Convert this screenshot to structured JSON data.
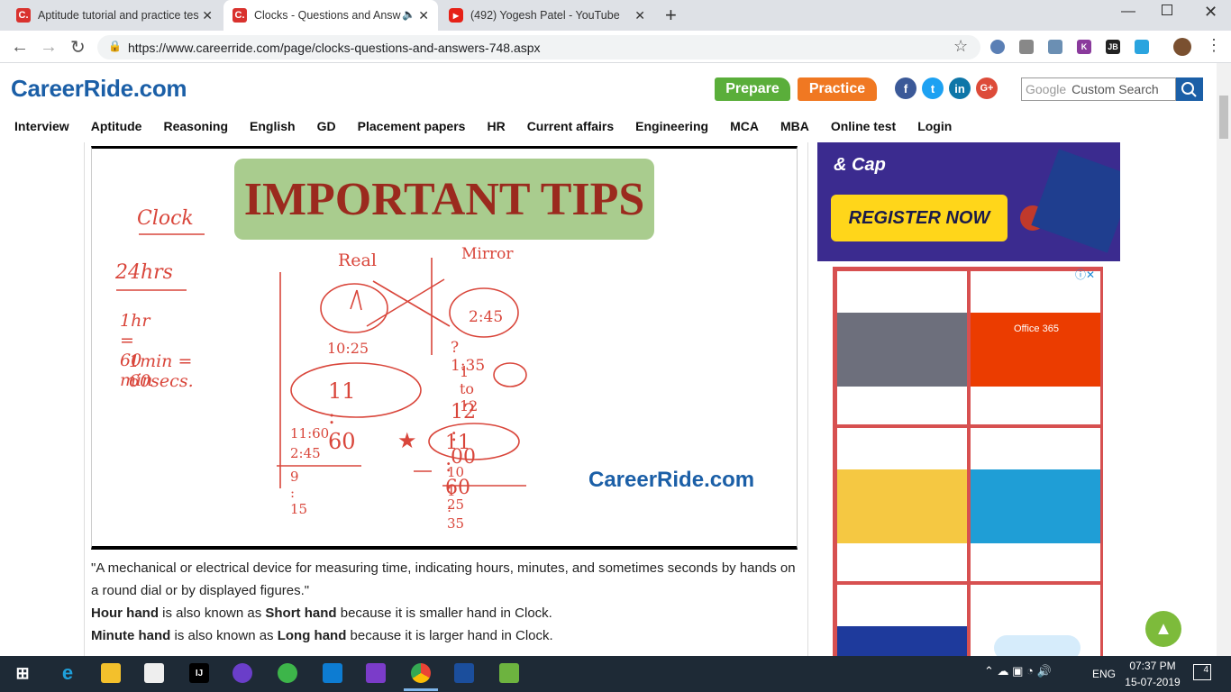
{
  "browser": {
    "tabs": [
      {
        "title": "Aptitude tutorial and practice tes",
        "favicon": "C."
      },
      {
        "title": "Clocks - Questions and Answ",
        "favicon": "C."
      },
      {
        "title": "(492) Yogesh Patel - YouTube"
      }
    ],
    "url": "https://www.careerride.com/page/clocks-questions-and-answers-748.aspx"
  },
  "site": {
    "logo": "CareerRide.com",
    "prepare_label": "Prepare",
    "practice_label": "Practice",
    "search_placeholder": "Custom Search",
    "google_label": "Google",
    "nav": [
      "Interview",
      "Aptitude",
      "Reasoning",
      "English",
      "GD",
      "Placement papers",
      "HR",
      "Current affairs",
      "Engineering",
      "MCA",
      "MBA",
      "Online test",
      "Login"
    ]
  },
  "image": {
    "tips_title": "IMPORTANT TIPS",
    "watermark": "CareerRide.com",
    "notes": {
      "clock": "Clock",
      "hrs": "24hrs",
      "hr": "1hr = 60 min",
      "min": "1min = 60secs.",
      "real": "Real",
      "mirror": "Mirror",
      "m1": "2:45",
      "r1": "10:25",
      "q1": "? 1:35",
      "to12": "1 to 12",
      "big": "11 : 60",
      "twelve": "12 : 00",
      "star": "11 : 60",
      "sub1": "11:60",
      "sub2": "2:45",
      "sub3": "9 : 15",
      "sub4": "10 : 25",
      "sub5": "1 : 35"
    }
  },
  "article": {
    "p1": "\"A mechanical or electrical device for measuring time, indicating hours, minutes, and sometimes seconds by hands on a round dial or by displayed figures.\"",
    "l1_b1": "Hour hand",
    "l1_t1": " is also known as ",
    "l1_b2": "Short hand",
    "l1_t2": " because it is smaller hand in Clock.",
    "l2_b1": "Minute hand",
    "l2_t1": " is also known as ",
    "l2_b2": "Long hand",
    "l2_t2": " because it is larger hand in Clock."
  },
  "ads": {
    "banner_line": "& Cap",
    "banner_cta": "REGISTER NOW",
    "office": "Office 365"
  },
  "taskbar": {
    "lang": "ENG",
    "time": "07:37 PM",
    "date": "15-07-2019",
    "notif": "4"
  }
}
